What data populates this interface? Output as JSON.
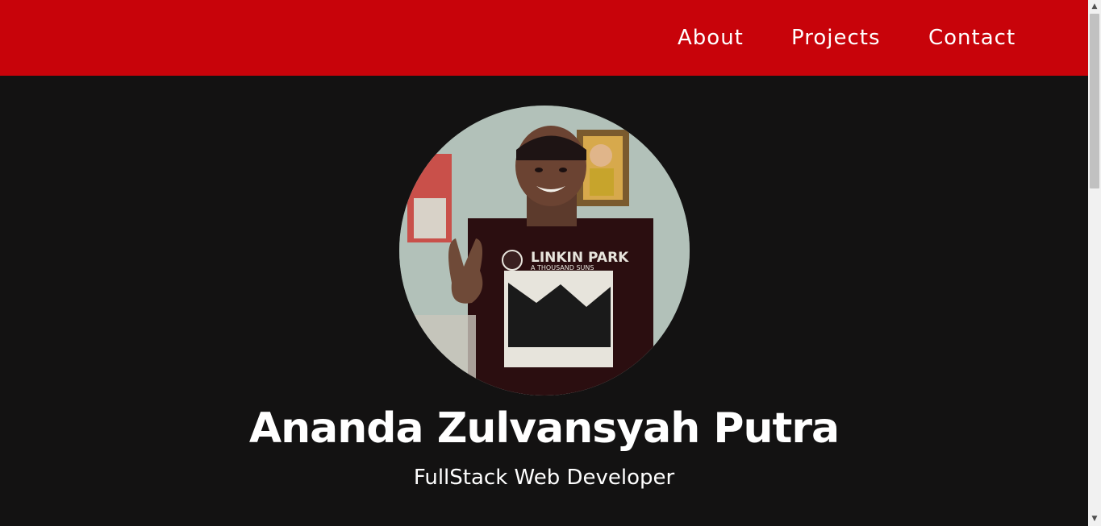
{
  "nav": {
    "links": [
      {
        "label": "About"
      },
      {
        "label": "Projects"
      },
      {
        "label": "Contact"
      }
    ]
  },
  "hero": {
    "name": "Ananda Zulvansyah Putra",
    "role": "FullStack Web Developer",
    "avatar_shirt_text_1": "LINKIN PARK",
    "avatar_shirt_text_2": "A THOUSAND SUNS"
  },
  "scrollbar": {
    "up_glyph": "▲",
    "down_glyph": "▼",
    "scroll_position": 0
  },
  "colors": {
    "navbar": "#c8030a",
    "background": "#131212",
    "text": "#ffffff"
  }
}
